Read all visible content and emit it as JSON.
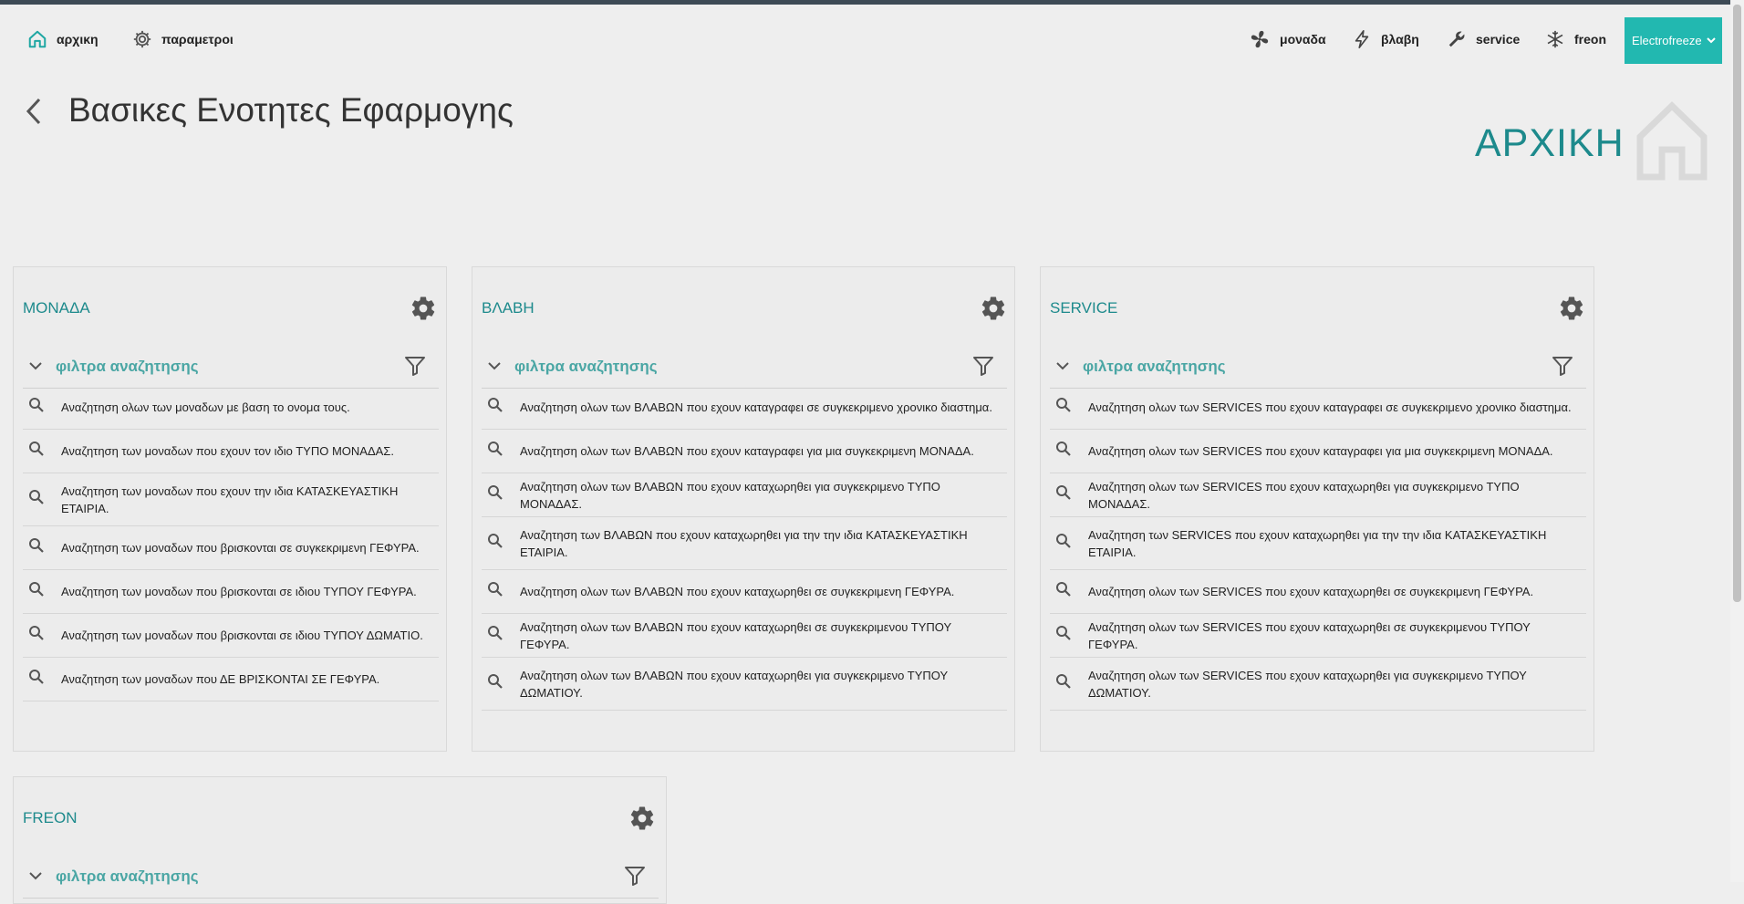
{
  "nav": {
    "home": "αρχικη",
    "params": "παραμετροι",
    "unit": "μοναδα",
    "fault": "βλαβη",
    "service": "service",
    "freon": "freon",
    "brand_select": "Electrofreeze"
  },
  "header": {
    "title": "Βασικες Ενοτητες Εφαρμογης",
    "section_name": "ΑΡΧΙΚΗ"
  },
  "cards": [
    {
      "title": "ΜΟΝΑΔΑ",
      "filters_label": "φιλτρα αναζητησης",
      "items": [
        "Αναζητηση ολων των μοναδων με βαση το ονομα τους.",
        "Αναζητηση των μοναδων που εχουν τον ιδιο ΤΥΠΟ ΜΟΝΑΔΑΣ.",
        "Αναζητηση των μοναδων που εχουν την ιδια ΚΑΤΑΣΚΕΥΑΣΤΙΚΗ ΕΤΑΙΡΙΑ.",
        "Αναζητηση των μοναδων που βρισκονται σε συγκεκριμενη ΓΕΦΥΡΑ.",
        "Αναζητηση των μοναδων που βρισκονται σε ιδιου ΤΥΠΟΥ ΓΕΦΥΡΑ.",
        "Αναζητηση των μοναδων που βρισκονται σε ιδιου ΤΥΠΟΥ ΔΩΜΑΤΙΟ.",
        "Αναζητηση των μοναδων που ΔΕ ΒΡΙΣΚΟΝΤΑΙ ΣΕ ΓΕΦΥΡΑ."
      ]
    },
    {
      "title": "ΒΛΑΒΗ",
      "filters_label": "φιλτρα αναζητησης",
      "items": [
        "Αναζητηση ολων των ΒΛΑΒΩΝ που εχουν καταγραφει σε συγκεκριμενο χρονικο διαστημα.",
        "Αναζητηση ολων των ΒΛΑΒΩΝ που εχουν καταγραφει για μια συγκεκριμενη ΜΟΝΑΔΑ.",
        "Αναζητηση ολων των ΒΛΑΒΩΝ που εχουν καταχωρηθει για συγκεκριμενο ΤΥΠΟ ΜΟΝΑΔΑΣ.",
        "Αναζητηση των ΒΛΑΒΩΝ που εχουν καταχωρηθει για την την ιδια ΚΑΤΑΣΚΕΥΑΣΤΙΚΗ ΕΤΑΙΡΙΑ.",
        "Αναζητηση ολων των ΒΛΑΒΩΝ που εχουν καταχωρηθει σε συγκεκριμενη ΓΕΦΥΡΑ.",
        "Αναζητηση ολων των ΒΛΑΒΩΝ που εχουν καταχωρηθει σε συγκεκριμενου ΤΥΠΟΥ ΓΕΦΥΡΑ.",
        "Αναζητηση ολων των ΒΛΑΒΩΝ που εχουν καταχωρηθει για συγκεκριμενο ΤΥΠΟΥ ΔΩΜΑΤΙΟΥ."
      ]
    },
    {
      "title": "SERVICE",
      "filters_label": "φιλτρα αναζητησης",
      "items": [
        "Αναζητηση ολων των SERVICES που εχουν καταγραφει σε συγκεκριμενο χρονικο διαστημα.",
        "Αναζητηση ολων των SERVICES που εχουν καταγραφει για μια συγκεκριμενη ΜΟΝΑΔΑ.",
        "Αναζητηση ολων των SERVICES που εχουν καταχωρηθει για συγκεκριμενο ΤΥΠΟ ΜΟΝΑΔΑΣ.",
        "Αναζητηση των SERVICES που εχουν καταχωρηθει για την την ιδια ΚΑΤΑΣΚΕΥΑΣΤΙΚΗ ΕΤΑΙΡΙΑ.",
        "Αναζητηση ολων των SERVICES που εχουν καταχωρηθει σε συγκεκριμενη ΓΕΦΥΡΑ.",
        "Αναζητηση ολων των SERVICES που εχουν καταχωρηθει σε συγκεκριμενου ΤΥΠΟΥ ΓΕΦΥΡΑ.",
        "Αναζητηση ολων των SERVICES που εχουν καταχωρηθει για συγκεκριμενο ΤΥΠΟΥ ΔΩΜΑΤΙΟΥ."
      ]
    },
    {
      "title": "FREON",
      "filters_label": "φιλτρα αναζητησης",
      "items": []
    }
  ],
  "colors": {
    "accent": "#1d8a8c",
    "filters_text": "#4aa6a4",
    "brand_select_bg": "#22b8b0"
  }
}
